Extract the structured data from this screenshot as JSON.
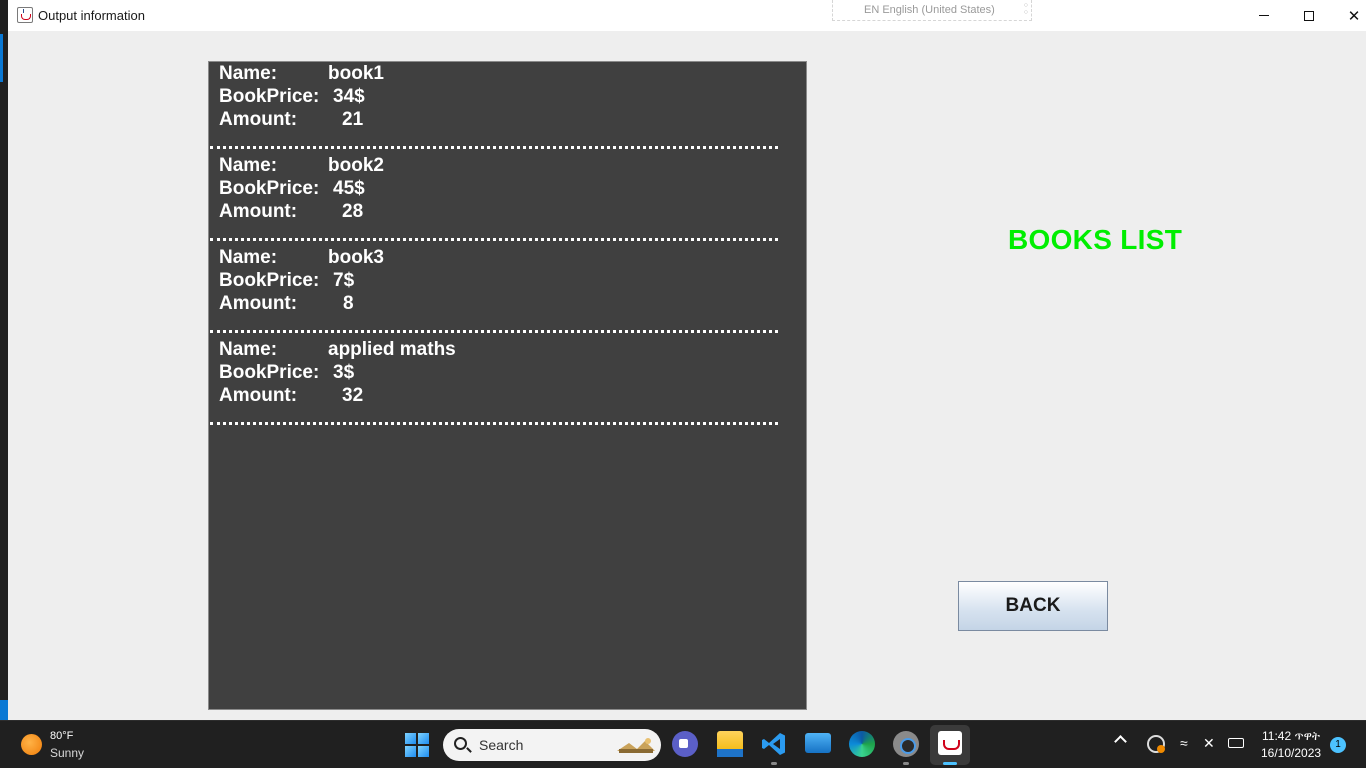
{
  "window": {
    "title": "Output information",
    "language_bar": "EN English (United States)"
  },
  "books": [
    {
      "name_label": "Name:",
      "name": "book1",
      "price_label": "BookPrice:",
      "price": "34$",
      "amount_label": "Amount:",
      "amount": "21"
    },
    {
      "name_label": "Name:",
      "name": "book2",
      "price_label": "BookPrice:",
      "price": "45$",
      "amount_label": "Amount:",
      "amount": "28"
    },
    {
      "name_label": "Name:",
      "name": "book3",
      "price_label": "BookPrice:",
      "price": "7$",
      "amount_label": "Amount:",
      "amount": "8"
    },
    {
      "name_label": "Name:",
      "name": "applied maths",
      "price_label": "BookPrice:",
      "price": "3$",
      "amount_label": "Amount:",
      "amount": "32"
    }
  ],
  "heading": {
    "text": "BOOKS LIST",
    "color": "#00ee00"
  },
  "back_button": {
    "label": "BACK"
  },
  "taskbar": {
    "weather_temp": "80°F",
    "weather_cond": "Sunny",
    "search_placeholder": "Search",
    "clock_time": "11:42 ጥዋት",
    "clock_date": "16/10/2023",
    "notification_count": "1",
    "pinned_icons": [
      "meet-icon",
      "file-explorer-icon",
      "vscode-icon",
      "remote-desktop-icon",
      "edge-icon",
      "settings-icon",
      "java-icon"
    ]
  }
}
